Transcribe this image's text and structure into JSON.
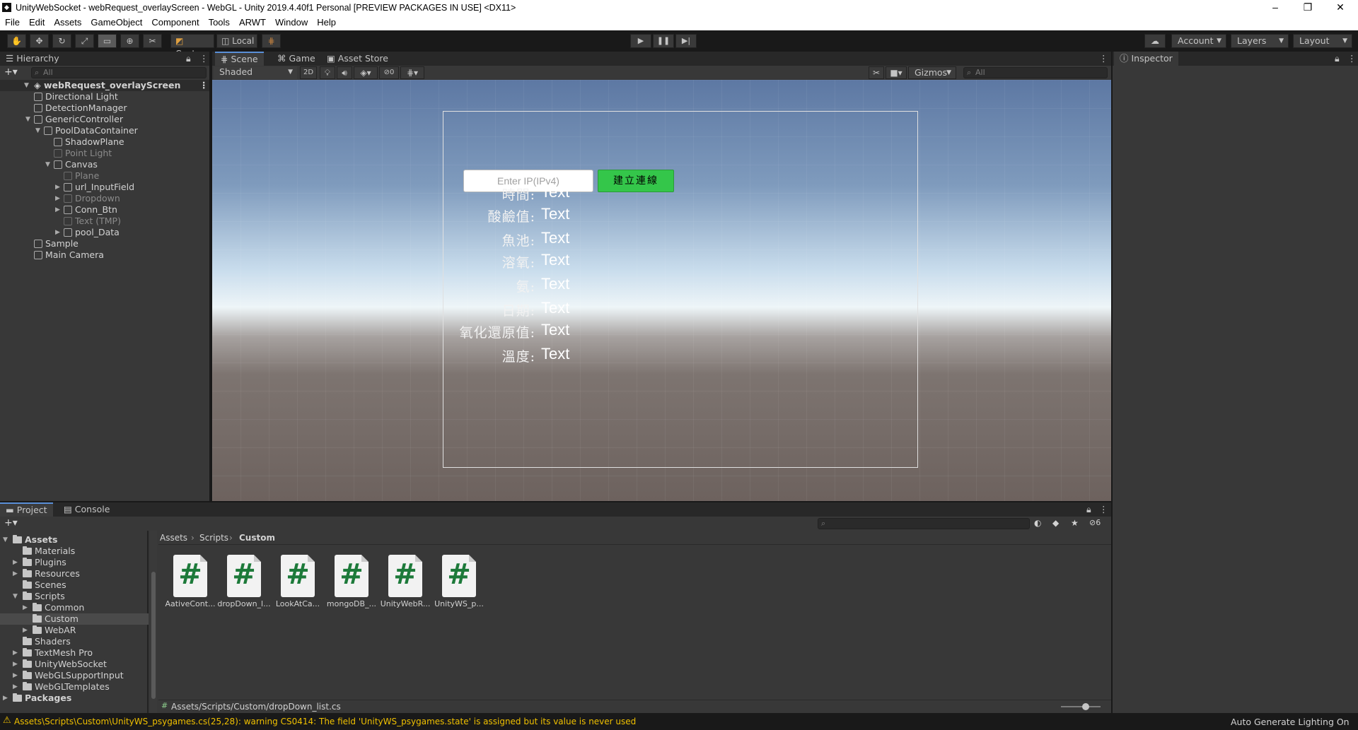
{
  "window": {
    "title": "UnityWebSocket - webRequest_overlayScreen - WebGL - Unity 2019.4.40f1 Personal [PREVIEW PACKAGES IN USE] <DX11>",
    "controls": [
      "minimize",
      "maximize",
      "close"
    ]
  },
  "menu": [
    "File",
    "Edit",
    "Assets",
    "GameObject",
    "Component",
    "Tools",
    "ARWT",
    "Window",
    "Help"
  ],
  "toolbar": {
    "pivot": "Center",
    "space": "Local",
    "account": "Account",
    "layers": "Layers",
    "layout": "Layout"
  },
  "hierarchy": {
    "tab": "Hierarchy",
    "search_placeholder": "All",
    "scene": "webRequest_overlayScreen",
    "items": [
      {
        "label": "Directional Light",
        "depth": 1,
        "active": true,
        "expandable": false
      },
      {
        "label": "DetectionManager",
        "depth": 1,
        "active": true,
        "expandable": false
      },
      {
        "label": "GenericController",
        "depth": 1,
        "active": true,
        "expandable": true
      },
      {
        "label": "PoolDataContainer",
        "depth": 2,
        "active": true,
        "expandable": true
      },
      {
        "label": "ShadowPlane",
        "depth": 3,
        "active": true,
        "expandable": false
      },
      {
        "label": "Point Light",
        "depth": 3,
        "active": false,
        "expandable": false
      },
      {
        "label": "Canvas",
        "depth": 3,
        "active": true,
        "expandable": true
      },
      {
        "label": "Plane",
        "depth": 4,
        "active": false,
        "expandable": false
      },
      {
        "label": "url_InputField",
        "depth": 4,
        "active": true,
        "expandable": true
      },
      {
        "label": "Dropdown",
        "depth": 4,
        "active": false,
        "expandable": true
      },
      {
        "label": "Conn_Btn",
        "depth": 4,
        "active": true,
        "expandable": true
      },
      {
        "label": "Text (TMP)",
        "depth": 4,
        "active": false,
        "expandable": false
      },
      {
        "label": "pool_Data",
        "depth": 4,
        "active": true,
        "expandable": true
      },
      {
        "label": "Sample",
        "depth": 1,
        "active": true,
        "expandable": false
      },
      {
        "label": "Main Camera",
        "depth": 1,
        "active": true,
        "expandable": false
      }
    ]
  },
  "scene_tabs": [
    "Scene",
    "Game",
    "Asset Store"
  ],
  "scene_toolbar": {
    "shading": "Shaded",
    "mode_2d": "2D",
    "hidden_count": "0",
    "gizmos": "Gizmos",
    "search_placeholder": "All"
  },
  "viewport": {
    "ip_placeholder": "Enter IP(IPv4)",
    "connect_button": "建立連線",
    "fields": [
      {
        "label": "時間:",
        "value": "Text"
      },
      {
        "label": "酸鹼值:",
        "value": "Text"
      },
      {
        "label": "魚池:",
        "value": "Text"
      },
      {
        "label": "溶氧:",
        "value": "Text"
      },
      {
        "label": "氨:",
        "value": "Text"
      },
      {
        "label": "日期:",
        "value": "Text"
      },
      {
        "label": "氧化還原值:",
        "value": "Text"
      },
      {
        "label": "溫度:",
        "value": "Text"
      }
    ]
  },
  "inspector": {
    "tab": "Inspector"
  },
  "project": {
    "tabs": [
      "Project",
      "Console"
    ],
    "hidden_count": "6",
    "breadcrumb": [
      "Assets",
      "Scripts",
      "Custom"
    ],
    "tree": [
      {
        "label": "Assets",
        "depth": 0,
        "bold": true,
        "expanded": true,
        "selected": false
      },
      {
        "label": "Materials",
        "depth": 1,
        "bold": false,
        "expanded": false,
        "selected": false,
        "arrow": false
      },
      {
        "label": "Plugins",
        "depth": 1,
        "bold": false,
        "expanded": false,
        "selected": false,
        "arrow": true
      },
      {
        "label": "Resources",
        "depth": 1,
        "bold": false,
        "expanded": false,
        "selected": false,
        "arrow": true
      },
      {
        "label": "Scenes",
        "depth": 1,
        "bold": false,
        "expanded": false,
        "selected": false,
        "arrow": false
      },
      {
        "label": "Scripts",
        "depth": 1,
        "bold": false,
        "expanded": true,
        "selected": false,
        "arrow": true
      },
      {
        "label": "Common",
        "depth": 2,
        "bold": false,
        "expanded": false,
        "selected": false,
        "arrow": true
      },
      {
        "label": "Custom",
        "depth": 2,
        "bold": false,
        "expanded": false,
        "selected": true,
        "arrow": false
      },
      {
        "label": "WebAR",
        "depth": 2,
        "bold": false,
        "expanded": false,
        "selected": false,
        "arrow": true
      },
      {
        "label": "Shaders",
        "depth": 1,
        "bold": false,
        "expanded": false,
        "selected": false,
        "arrow": false
      },
      {
        "label": "TextMesh Pro",
        "depth": 1,
        "bold": false,
        "expanded": false,
        "selected": false,
        "arrow": true
      },
      {
        "label": "UnityWebSocket",
        "depth": 1,
        "bold": false,
        "expanded": false,
        "selected": false,
        "arrow": true
      },
      {
        "label": "WebGLSupportInput",
        "depth": 1,
        "bold": false,
        "expanded": false,
        "selected": false,
        "arrow": true
      },
      {
        "label": "WebGLTemplates",
        "depth": 1,
        "bold": false,
        "expanded": false,
        "selected": false,
        "arrow": true
      },
      {
        "label": "Packages",
        "depth": 0,
        "bold": true,
        "expanded": false,
        "selected": false
      }
    ],
    "files": [
      "AativeCont...",
      "dropDown_l...",
      "LookAtCa...",
      "mongoDB_...",
      "UnityWebR...",
      "UnityWS_p..."
    ],
    "selected_path": "Assets/Scripts/Custom/dropDown_list.cs"
  },
  "status": {
    "warning": "Assets\\Scripts\\Custom\\UnityWS_psygames.cs(25,28): warning CS0414: The field 'UnityWS_psygames.state' is assigned but its value is never used",
    "right": "Auto Generate Lighting On"
  }
}
